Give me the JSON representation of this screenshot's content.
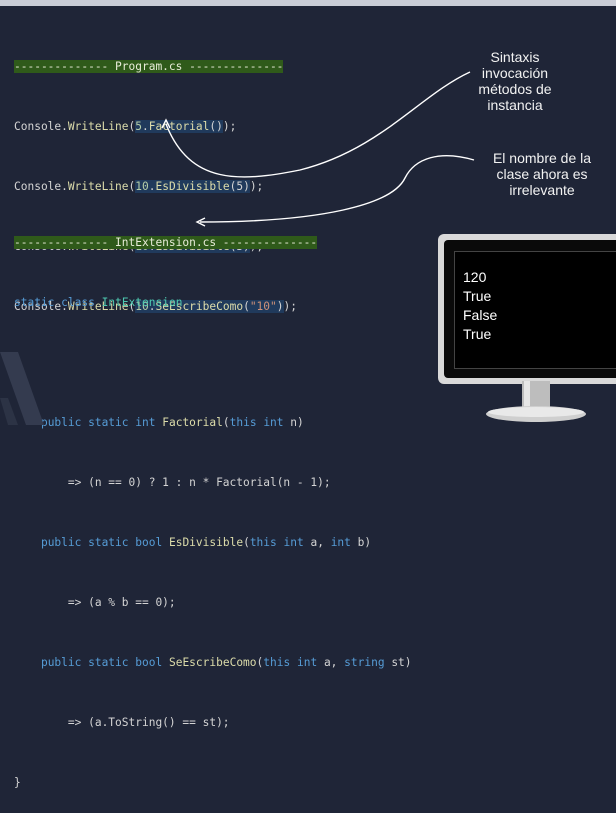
{
  "program_block": {
    "header": "-------------- Program.cs --------------",
    "lines": [
      {
        "prefix": "Console.",
        "fn": "WriteLine",
        "open": "(",
        "num": "5",
        "dot": ".",
        "method": "Factorial",
        "args": "()",
        "close": ");"
      },
      {
        "prefix": "Console.",
        "fn": "WriteLine",
        "open": "(",
        "num": "10",
        "dot": ".",
        "method": "EsDivisible",
        "args": "(5)",
        "close": ");"
      },
      {
        "prefix": "Console.",
        "fn": "WriteLine",
        "open": "(",
        "num": "10",
        "dot": ".",
        "method": "EsDivisible",
        "args": "(3)",
        "close": ");"
      },
      {
        "prefix": "Console.",
        "fn": "WriteLine",
        "open": "(",
        "num": "10",
        "dot": ".",
        "method": "SeEscribeComo",
        "args_open": "(",
        "str": "\"10\"",
        "args_close": ")",
        "close": ");"
      }
    ]
  },
  "extension_block": {
    "header": "-------------- IntExtension.cs --------------",
    "kw_static": "static",
    "kw_class": "class",
    "class_name": "IntExtension",
    "brace_open": "{",
    "brace_close": "}",
    "m1": {
      "mods": "public static",
      "type": "int",
      "name": "Factorial",
      "p_open": "(",
      "this": "this",
      "ptype": "int",
      "pname": " n)",
      "body": "=> (n == 0) ? 1 : n * Factorial(n - 1);"
    },
    "m2": {
      "mods": "public static",
      "type": "bool",
      "name": "EsDivisible",
      "p_open": "(",
      "this": "this",
      "ptype": "int",
      "pname": " a, ",
      "ptype2": "int",
      "pname2": " b)",
      "body": "=> (a % b == 0);"
    },
    "m3": {
      "mods": "public static",
      "type": "bool",
      "name": "SeEscribeComo",
      "p_open": "(",
      "this": "this",
      "ptype": "int",
      "pname": " a, ",
      "ptype2": "string",
      "pname2": " st)",
      "body": "=> (a.ToString() == st);"
    }
  },
  "annotations": {
    "note1": [
      "Sintaxis",
      "invocación",
      "métodos de",
      "instancia"
    ],
    "note2": [
      "El nombre de la",
      "clase ahora es",
      "irrelevante"
    ]
  },
  "output": [
    "120",
    "True",
    "False",
    "True"
  ],
  "colors": {
    "background": "#1f2537",
    "header_bg": "#2f5a1a",
    "keyword": "#569cd6",
    "type": "#4ec9b0",
    "method": "#dcdcaa",
    "number": "#b5cea8",
    "string": "#ce9178"
  }
}
